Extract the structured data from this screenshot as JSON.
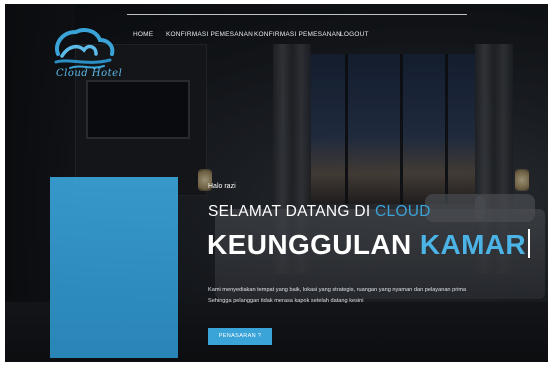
{
  "brand": {
    "logo_text": "Cloud Hotel",
    "logo_icon": "cloud-wave-icon",
    "accent_color": "#3aa3d8"
  },
  "nav": {
    "items": [
      {
        "label": "HOME"
      },
      {
        "label": "KONFIRMASI PEMESANAN"
      },
      {
        "label": "KONFIRMASI PEMESANAN"
      },
      {
        "label": "LOGOUT"
      }
    ]
  },
  "hero": {
    "greeting": "Halo razi",
    "welcome_prefix": "SELAMAT DATANG DI ",
    "welcome_accent": "CLOUD",
    "headline_prefix": "KEUNGGULAN ",
    "headline_accent": "KAMAR",
    "description_lines": [
      "Kami menyediakan tempat yang baik, lokasi yang strategis, ruangan yang nyaman dan pelayanan prima",
      "Sehingga pelanggan tidak merasa kapok setelah datang kesini"
    ],
    "cta_label": "PENASARAN ?"
  }
}
